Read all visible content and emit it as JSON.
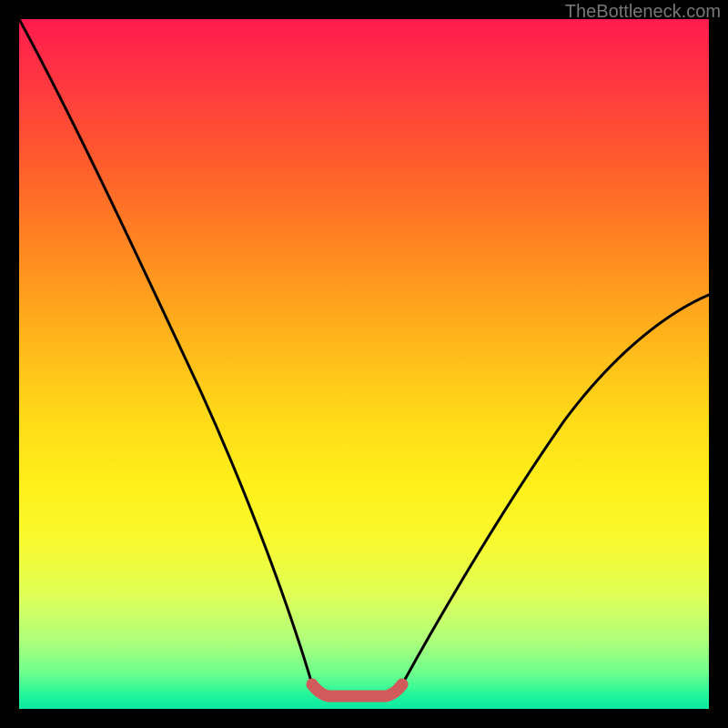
{
  "watermark": "TheBottleneck.com",
  "chart_data": {
    "type": "line",
    "title": "",
    "xlabel": "",
    "ylabel": "",
    "xlim": [
      0,
      100
    ],
    "ylim": [
      0,
      100
    ],
    "series": [
      {
        "name": "left-curve",
        "x": [
          0,
          3,
          6,
          10,
          14,
          18,
          22,
          26,
          30,
          34,
          37,
          40,
          42.5
        ],
        "y": [
          100,
          94,
          87,
          78,
          69,
          60,
          51,
          42,
          33,
          24,
          16,
          9,
          3.6
        ]
      },
      {
        "name": "bottom-span",
        "x": [
          42.5,
          43.5,
          45,
          47,
          49,
          51,
          53,
          54.5,
          55.5
        ],
        "y": [
          3.6,
          2.7,
          2.2,
          2.0,
          2.0,
          2.2,
          2.5,
          3.0,
          3.6
        ]
      },
      {
        "name": "right-curve",
        "x": [
          55.5,
          58,
          62,
          66,
          70,
          75,
          80,
          85,
          90,
          95,
          100
        ],
        "y": [
          3.6,
          7,
          13,
          20,
          26,
          33,
          40,
          46,
          51,
          56,
          60
        ]
      }
    ],
    "overlay": {
      "name": "valley-highlight",
      "color": "#d15a5a",
      "x": [
        42.5,
        43.5,
        45,
        47,
        49,
        51,
        53,
        54.5,
        55.5
      ],
      "y": [
        3.6,
        2.7,
        2.2,
        2.0,
        2.0,
        2.2,
        2.5,
        3.0,
        3.6
      ]
    },
    "gradient_stops": [
      {
        "pos": 0,
        "color": "#ff1a4d"
      },
      {
        "pos": 50,
        "color": "#ffd018"
      },
      {
        "pos": 100,
        "color": "#0be8a4"
      }
    ]
  }
}
